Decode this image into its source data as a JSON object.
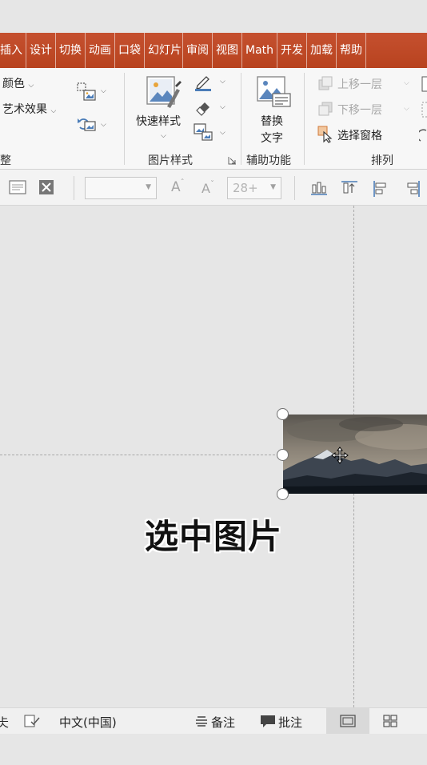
{
  "ribbon_tabs": [
    "插入",
    "设计",
    "切换",
    "动画",
    "口袋",
    "幻灯片",
    "审阅",
    "视图",
    "Math",
    "开发",
    "加载",
    "帮助"
  ],
  "ribbon": {
    "art_styles": {
      "color_label": "颜色",
      "effects_label": "艺术效果",
      "group_label_fragment": "整"
    },
    "picture_styles": {
      "quick_styles_label": "快速样式",
      "group_label": "图片样式"
    },
    "accessibility": {
      "alt_text_line1": "替换",
      "alt_text_line2": "文字",
      "group_label": "辅助功能"
    },
    "arrange": {
      "bring_forward": "上移一层",
      "send_backward": "下移一层",
      "selection_pane": "选择窗格",
      "group_label": "排列"
    }
  },
  "format_bar": {
    "font_name": "",
    "font_size": "28+",
    "grow_font": "A",
    "shrink_font": "A"
  },
  "canvas": {
    "caption": "选中图片"
  },
  "status_bar": {
    "left_fragment": "仧",
    "language": "中文(中国)",
    "notes": "备注",
    "comments": "批注"
  },
  "colors": {
    "ribbon_tab_bg": "#c5502f",
    "ribbon_bg": "#f7f7f7",
    "canvas_bg": "#e6e6e6",
    "status_bg": "#f0f0f0",
    "active_view_bg": "#d9d9d9"
  },
  "icons": [
    "picture-color-icon",
    "artistic-effects-icon",
    "compress-pictures-icon",
    "reset-picture-icon",
    "quick-styles-icon",
    "picture-border-icon",
    "picture-effects-icon",
    "picture-layout-icon",
    "alt-text-icon",
    "bring-forward-icon",
    "send-backward-icon",
    "selection-pane-icon",
    "align-icon",
    "group-icon",
    "rotate-icon",
    "move-cursor-icon",
    "normal-view-icon",
    "slide-sorter-icon",
    "notes-icon",
    "comments-icon",
    "accessibility-check-icon"
  ]
}
